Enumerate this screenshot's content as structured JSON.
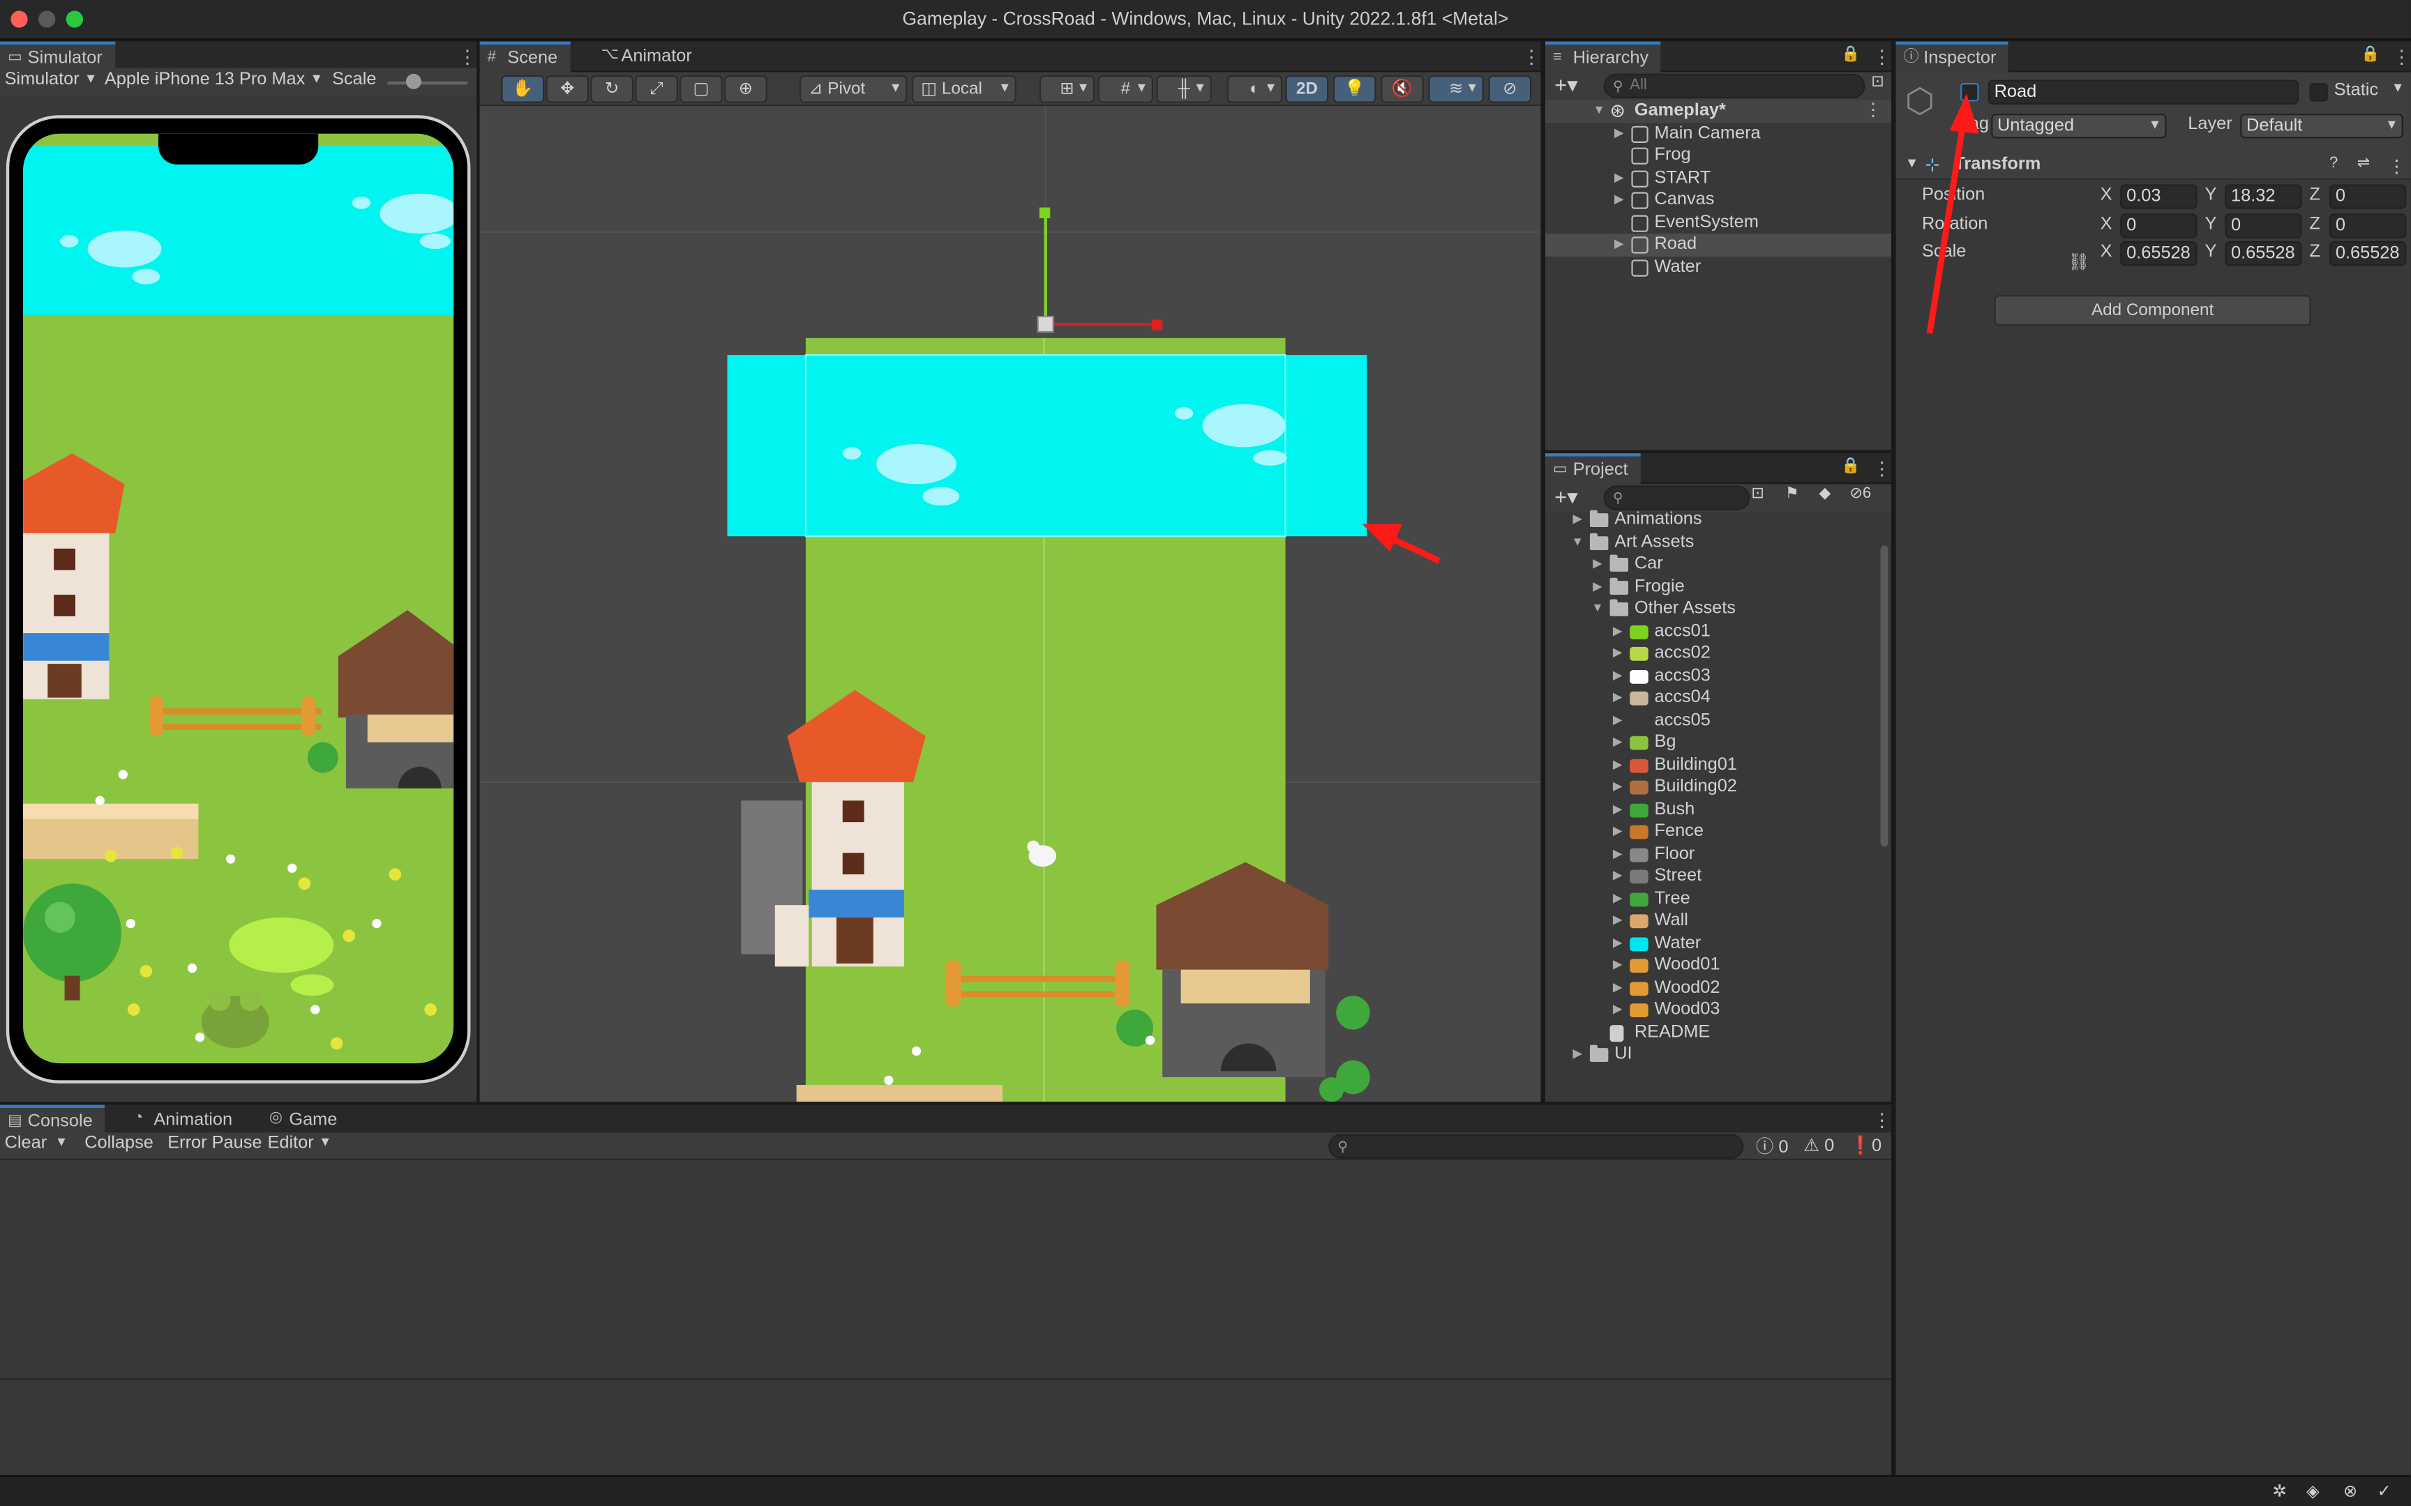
{
  "window": {
    "title": "Gameplay - CrossRoad - Windows, Mac, Linux - Unity 2022.1.8f1 <Metal>"
  },
  "simulator": {
    "tab": "Simulator",
    "mode": "Simulator",
    "device": "Apple iPhone 13 Pro Max",
    "scale_label": "Scale"
  },
  "scene": {
    "tabs": [
      "Scene",
      "Animator"
    ],
    "pivot": "Pivot",
    "local": "Local",
    "mode_2d": "2D"
  },
  "hierarchy": {
    "tab": "Hierarchy",
    "search_placeholder": "All",
    "root": "Gameplay*",
    "items": [
      "Main Camera",
      "Frog",
      "START",
      "Canvas",
      "EventSystem",
      "Road",
      "Water"
    ],
    "selected": "Road"
  },
  "project": {
    "tab": "Project",
    "hidden_count": "6",
    "folders": [
      "Animations",
      "Art Assets",
      "Car",
      "Frogie",
      "Other Assets"
    ],
    "assets": [
      "accs01",
      "accs02",
      "accs03",
      "accs04",
      "accs05",
      "Bg",
      "Building01",
      "Building02",
      "Bush",
      "Fence",
      "Floor",
      "Street",
      "Tree",
      "Wall",
      "Water",
      "Wood01",
      "Wood02",
      "Wood03"
    ],
    "files": [
      "README",
      "UI"
    ]
  },
  "inspector": {
    "tab": "Inspector",
    "object_name": "Road",
    "static_label": "Static",
    "tag_label": "Tag",
    "tag_value": "Untagged",
    "layer_label": "Layer",
    "layer_value": "Default",
    "component": "Transform",
    "position": {
      "label": "Position",
      "x": "0.03",
      "y": "18.32",
      "z": "0"
    },
    "rotation": {
      "label": "Rotation",
      "x": "0",
      "y": "0",
      "z": "0"
    },
    "scale": {
      "label": "Scale",
      "x": "0.65528",
      "y": "0.65528",
      "z": "0.65528"
    },
    "add_component": "Add Component"
  },
  "console": {
    "tabs": [
      "Console",
      "Animation",
      "Game"
    ],
    "clear": "Clear",
    "collapse": "Collapse",
    "error_pause": "Error Pause",
    "editor": "Editor",
    "counts": {
      "info": "0",
      "warning": "0",
      "error": "0"
    }
  },
  "colors": {
    "water": "#00f5f0",
    "grass": "#8bc53f",
    "annotation_arrow": "#ff1a1a",
    "accent_blue": "#3a79bb"
  }
}
